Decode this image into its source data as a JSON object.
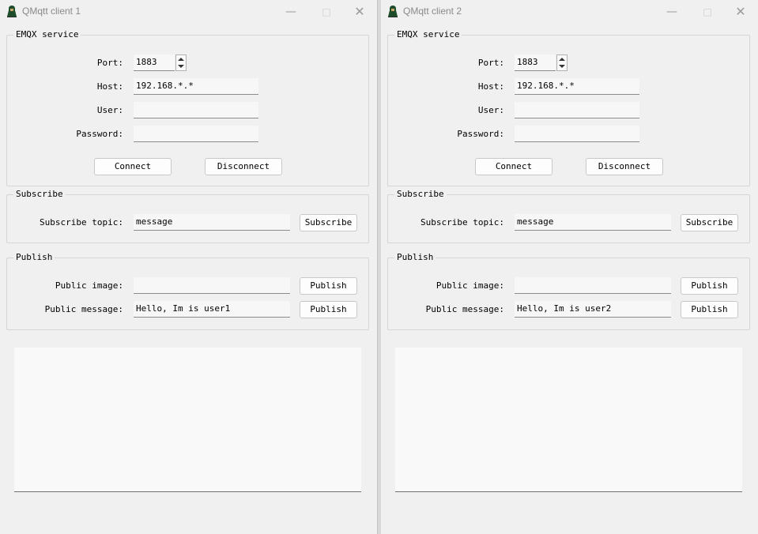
{
  "windows": [
    {
      "title": "QMqtt client 1",
      "emqx": {
        "group_title": "EMQX service",
        "port_label": "Port:",
        "port_value": "1883",
        "host_label": "Host:",
        "host_value": "192.168.*.*",
        "user_label": "User:",
        "user_value": "",
        "password_label": "Password:",
        "password_value": "",
        "connect_label": "Connect",
        "disconnect_label": "Disconnect"
      },
      "subscribe": {
        "group_title": "Subscribe",
        "topic_label": "Subscribe topic:",
        "topic_value": "message",
        "button_label": "Subscribe"
      },
      "publish": {
        "group_title": "Publish",
        "image_label": "Public image:",
        "image_value": "",
        "image_button": "Publish",
        "message_label": "Public message:",
        "message_value": "Hello, Im is user1",
        "message_button": "Publish"
      },
      "output_text": ""
    },
    {
      "title": "QMqtt client 2",
      "emqx": {
        "group_title": "EMQX service",
        "port_label": "Port:",
        "port_value": "1883",
        "host_label": "Host:",
        "host_value": "192.168.*.*",
        "user_label": "User:",
        "user_value": "",
        "password_label": "Password:",
        "password_value": "",
        "connect_label": "Connect",
        "disconnect_label": "Disconnect"
      },
      "subscribe": {
        "group_title": "Subscribe",
        "topic_label": "Subscribe topic:",
        "topic_value": "message",
        "button_label": "Subscribe"
      },
      "publish": {
        "group_title": "Publish",
        "image_label": "Public image:",
        "image_value": "",
        "image_button": "Publish",
        "message_label": "Public message:",
        "message_value": "Hello, Im is user2",
        "message_button": "Publish"
      },
      "output_text": ""
    }
  ],
  "icons": {
    "app": "app-icon",
    "minimize": "minimize-icon",
    "maximize": "maximize-icon",
    "close": "close-icon",
    "spin_up": "spin-up-icon",
    "spin_down": "spin-down-icon"
  },
  "colors": {
    "window_bg": "#f0f0f0",
    "field_bg": "#f7f7f7",
    "title_text": "#8a8a8a",
    "app_icon_green": "#1f4d2b"
  }
}
